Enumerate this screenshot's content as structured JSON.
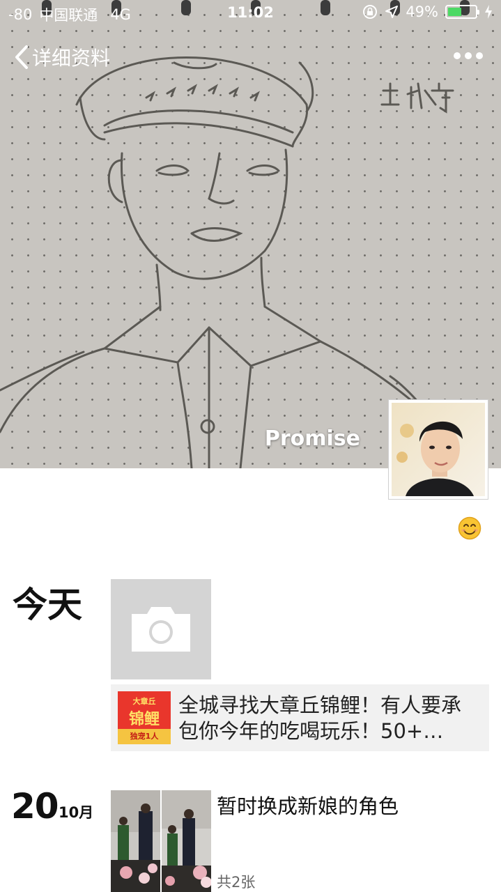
{
  "status_bar": {
    "signal": "-80",
    "carrier": "中国联通",
    "network": "4G",
    "time": "11:02",
    "battery_percent": "49%",
    "battery_level": 0.49,
    "icons": [
      "orientation-lock-icon",
      "location-icon",
      "battery-icon",
      "charging-icon"
    ]
  },
  "nav": {
    "back_label": "详细资料",
    "more_icon": "more-dots-icon"
  },
  "profile": {
    "name": "Promise",
    "cover_icon": "pencil-sketch-cover",
    "avatar_icon": "avatar-photo",
    "signature_emoji": "😊"
  },
  "moments": [
    {
      "date_label": "今天",
      "camera_icon": "camera-icon",
      "link": {
        "thumb_top": "大章丘",
        "thumb_main": "锦鲤",
        "thumb_bottom": "独宠1人",
        "title": "全城寻找大章丘锦鲤！有人要承包你今年的吃喝玩乐！50+…"
      }
    },
    {
      "day": "20",
      "month": "10月",
      "text": "暂时换成新娘的角色",
      "count": "共2张"
    }
  ],
  "colors": {
    "cover_bg": "#c8c5c0",
    "battery_fill": "#4cd964",
    "link_card_bg": "#f1f1f1",
    "camera_tile_bg": "#d4d4d4"
  }
}
